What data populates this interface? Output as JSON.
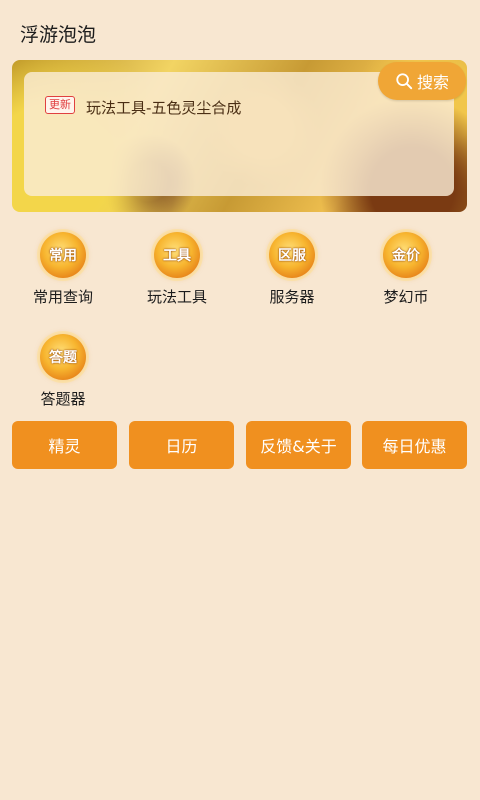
{
  "app": {
    "title": "浮游泡泡"
  },
  "banner": {
    "badge": "更新",
    "update_text": "玩法工具-五色灵尘合成",
    "search_label": "搜索"
  },
  "grid": {
    "items": [
      {
        "icon_text": "常用",
        "label": "常用查询",
        "icon": "orb-icon"
      },
      {
        "icon_text": "工具",
        "label": "玩法工具",
        "icon": "orb-icon"
      },
      {
        "icon_text": "区服",
        "label": "服务器",
        "icon": "orb-icon"
      },
      {
        "icon_text": "金价",
        "label": "梦幻币",
        "icon": "orb-icon"
      },
      {
        "icon_text": "答题",
        "label": "答题器",
        "icon": "orb-icon"
      }
    ]
  },
  "actions": {
    "buttons": [
      "精灵",
      "日历",
      "反馈&关于",
      "每日优惠"
    ]
  },
  "colors": {
    "background": "#f8e7d1",
    "accent": "#f0901f",
    "search_button": "#f0a636",
    "badge_red": "#e04040"
  }
}
